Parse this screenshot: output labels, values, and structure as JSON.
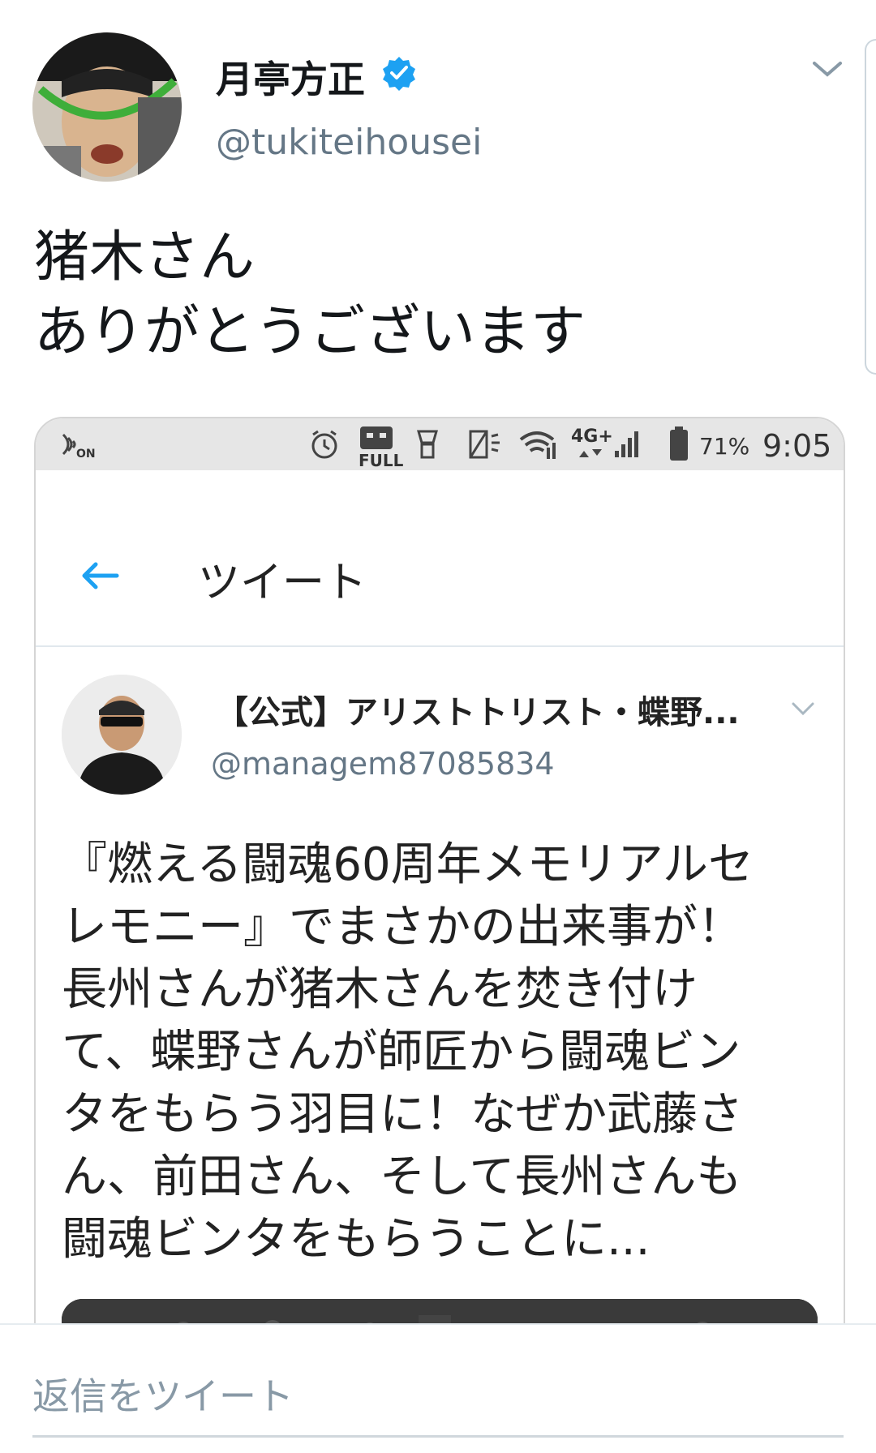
{
  "tweet": {
    "author_name": "月亭方正",
    "author_handle": "@tukiteihousei",
    "verified": true,
    "text_lines": [
      "猪木さん",
      "ありがとうございます"
    ]
  },
  "embedded_screenshot": {
    "status_bar": {
      "nfc_label": "ON",
      "full_label": "FULL",
      "network_label": "4G+",
      "battery": "71%",
      "time": "9:05"
    },
    "app_bar": {
      "title": "ツイート"
    },
    "quoted_tweet": {
      "author_name": "【公式】アリストトリスト・蝶野...",
      "author_handle": "@managem87085834",
      "text_lines": [
        "『燃える闘魂60周年メモリアルセ",
        "レモニー』でまさかの出来事が！",
        "長州さんが猪木さんを焚き付け",
        "て、蝶野さんが師匠から闘魂ビン",
        "タをもらう羽目に！なぜか武藤さ",
        "ん、前田さん、そして長州さんも",
        "闘魂ビンタをもらうことに..."
      ]
    }
  },
  "reply": {
    "placeholder": "返信をツイート"
  },
  "colors": {
    "accent": "#1da1f2",
    "secondary_text": "#657786"
  }
}
